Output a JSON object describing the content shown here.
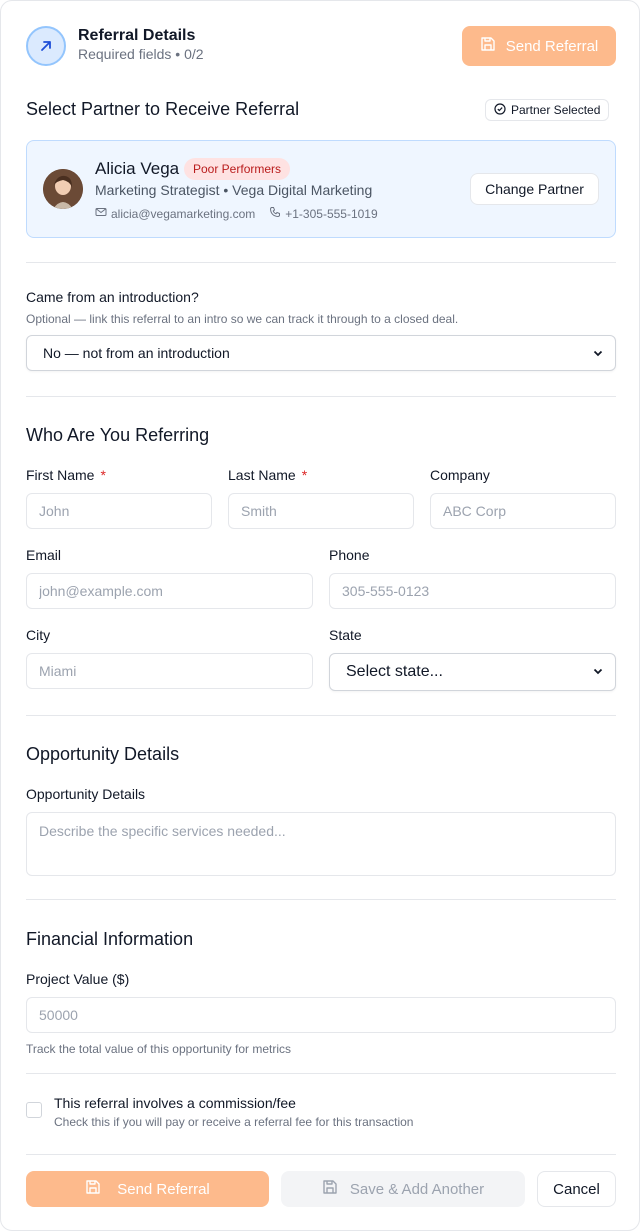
{
  "header": {
    "title": "Referral Details",
    "subtitle": "Required fields • 0/2",
    "send_label": "Send Referral"
  },
  "partner_section": {
    "title": "Select Partner to Receive Referral",
    "selected_badge": "Partner Selected",
    "partner": {
      "name": "Alicia Vega",
      "tag": "Poor Performers",
      "role": "Marketing Strategist • Vega Digital Marketing",
      "email": "alicia@vegamarketing.com",
      "phone": "+1-305-555-1019"
    },
    "change_label": "Change Partner"
  },
  "introduction": {
    "label": "Came from an introduction?",
    "hint": "Optional — link this referral to an intro so we can track it through to a closed deal.",
    "selected": "No — not from an introduction"
  },
  "referring": {
    "title": "Who Are You Referring",
    "first_name": {
      "label": "First Name",
      "required": "*",
      "placeholder": "John"
    },
    "last_name": {
      "label": "Last Name",
      "required": "*",
      "placeholder": "Smith"
    },
    "company": {
      "label": "Company",
      "placeholder": "ABC Corp"
    },
    "email": {
      "label": "Email",
      "placeholder": "john@example.com"
    },
    "phone": {
      "label": "Phone",
      "placeholder": "305-555-0123"
    },
    "city": {
      "label": "City",
      "placeholder": "Miami"
    },
    "state": {
      "label": "State",
      "selected": "Select state..."
    }
  },
  "opportunity": {
    "title": "Opportunity Details",
    "label": "Opportunity Details",
    "placeholder": "Describe the specific services needed..."
  },
  "financial": {
    "title": "Financial Information",
    "label": "Project Value ($)",
    "placeholder": "50000",
    "hint": "Track the total value of this opportunity for metrics"
  },
  "commission": {
    "label": "This referral involves a commission/fee",
    "hint": "Check this if you will pay or receive a referral fee for this transaction"
  },
  "footer": {
    "send_label": "Send Referral",
    "save_add_label": "Save & Add Another",
    "cancel_label": "Cancel"
  },
  "colors": {
    "accent": "#fdba8c",
    "tag_bg": "#fee2e2",
    "tag_text": "#b91c1c",
    "partner_bg": "#eff6ff"
  }
}
